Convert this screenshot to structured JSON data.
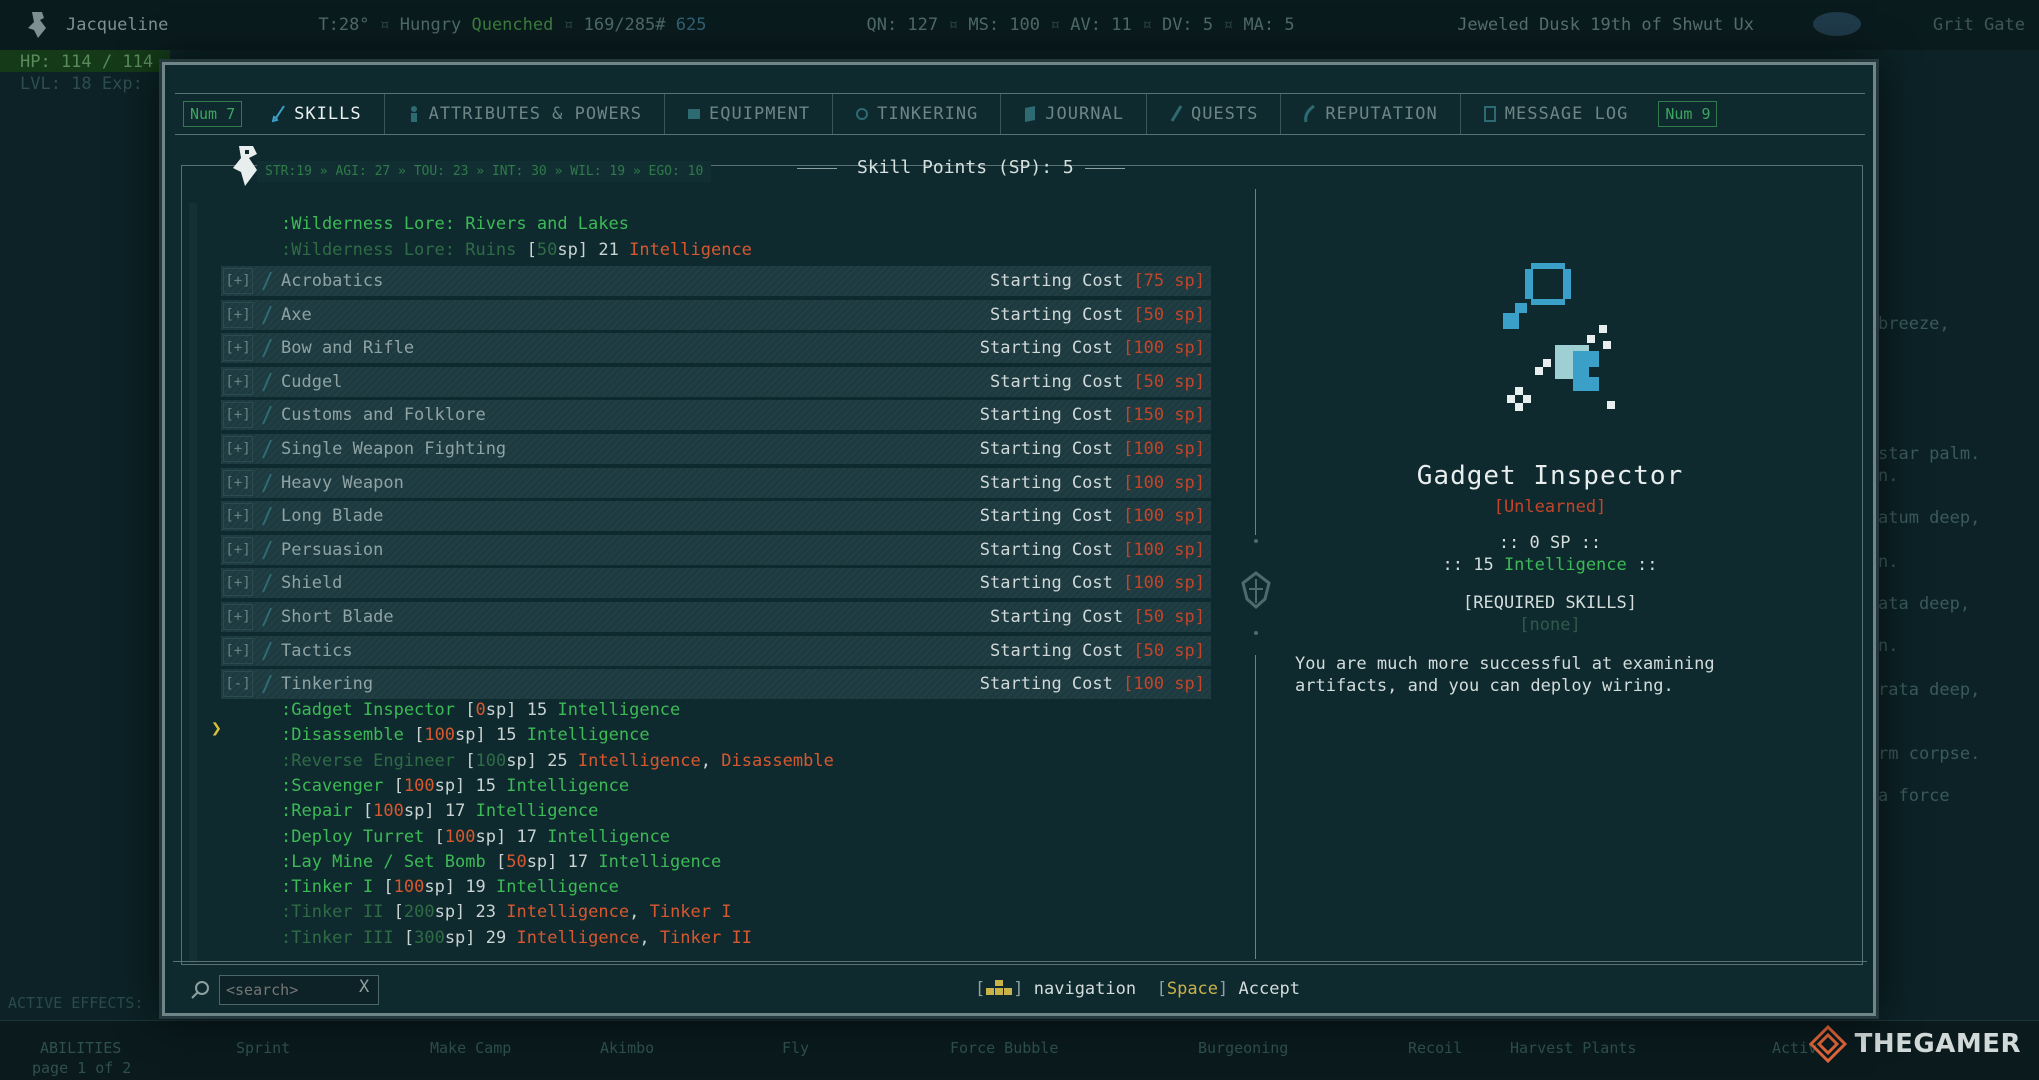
{
  "hud": {
    "player_name": "Jacqueline",
    "temperature": "T:28°",
    "hunger": "Hungry",
    "thirst": "Quenched",
    "weight": "169/285#",
    "drams": "625",
    "qn": "QN: 127",
    "ms": "MS: 100",
    "av": "AV: 11",
    "dv": "DV: 5",
    "ma": "MA: 5",
    "date": "Jeweled Dusk 19th of Shwut Ux",
    "zone": "Grit Gate",
    "hp": "HP: 114 / 114",
    "lvl": "LVL: 18 Exp:",
    "bg_lines": [
      "breeze,",
      "star palm.",
      "n.",
      "atum deep,",
      "n.",
      "ata deep,",
      "n.",
      "rata deep,",
      "rm corpse.",
      "a force"
    ],
    "active_effects": "ACTIVE EFFECTS:",
    "abilities_label": "ABILITIES",
    "abilities_page": "page 1 of 2",
    "abilities": [
      "Sprint",
      "Make Camp",
      "Akimbo",
      "Fly",
      "Force Bubble",
      "Burgeoning",
      "Recoil",
      "Harvest Plants",
      "Activ"
    ],
    "watermark": "THEGAMER"
  },
  "tabs": {
    "left_hotkey": "Num 7",
    "right_hotkey": "Num 9",
    "items": [
      {
        "label": "SKILLS",
        "icon": "sword-icon"
      },
      {
        "label": "ATTRIBUTES & POWERS",
        "icon": "figure-icon"
      },
      {
        "label": "EQUIPMENT",
        "icon": "armor-icon"
      },
      {
        "label": "TINKERING",
        "icon": "gear-icon"
      },
      {
        "label": "JOURNAL",
        "icon": "book-icon"
      },
      {
        "label": "QUESTS",
        "icon": "quill-icon"
      },
      {
        "label": "REPUTATION",
        "icon": "feather-icon"
      },
      {
        "label": "MESSAGE LOG",
        "icon": "scroll-icon"
      }
    ]
  },
  "stats_line": "STR:19 » AGI: 27 » TOU: 23 » INT: 30 » WIL: 19 » EGO: 10",
  "skill_points": "Skill Points (SP): 5",
  "subskills_top": {
    "rivers": ":Wilderness Lore: Rivers and Lakes",
    "ruins_name": ":Wilderness Lore: Ruins",
    "ruins_cost_num": "50",
    "ruins_req_num": "21",
    "ruins_req_attr": "Intelligence"
  },
  "skills": [
    {
      "name": "Acrobatics",
      "toggle": "[+]",
      "cost": "[75 sp]"
    },
    {
      "name": "Axe",
      "toggle": "[+]",
      "cost": "[50 sp]"
    },
    {
      "name": "Bow and Rifle",
      "toggle": "[+]",
      "cost": "[100 sp]"
    },
    {
      "name": "Cudgel",
      "toggle": "[+]",
      "cost": "[50 sp]"
    },
    {
      "name": "Customs and Folklore",
      "toggle": "[+]",
      "cost": "[150 sp]"
    },
    {
      "name": "Single Weapon Fighting",
      "toggle": "[+]",
      "cost": "[100 sp]"
    },
    {
      "name": "Heavy Weapon",
      "toggle": "[+]",
      "cost": "[100 sp]"
    },
    {
      "name": "Long Blade",
      "toggle": "[+]",
      "cost": "[100 sp]"
    },
    {
      "name": "Persuasion",
      "toggle": "[+]",
      "cost": "[100 sp]"
    },
    {
      "name": "Shield",
      "toggle": "[+]",
      "cost": "[100 sp]"
    },
    {
      "name": "Short Blade",
      "toggle": "[+]",
      "cost": "[50 sp]"
    },
    {
      "name": "Tactics",
      "toggle": "[+]",
      "cost": "[50 sp]"
    },
    {
      "name": "Tinkering",
      "toggle": "[-]",
      "cost": "[100 sp]"
    }
  ],
  "cost_label": "Starting Cost",
  "tinkering_subskills": [
    {
      "name": ":Gadget Inspector",
      "cost": "0",
      "level": "15",
      "reqs": [
        {
          "t": "Intelligence",
          "ok": true
        }
      ],
      "avail": true
    },
    {
      "name": ":Disassemble",
      "cost": "100",
      "level": "15",
      "reqs": [
        {
          "t": "Intelligence",
          "ok": true
        }
      ],
      "avail": true
    },
    {
      "name": ":Reverse Engineer",
      "cost": "100",
      "level": "25",
      "reqs": [
        {
          "t": "Intelligence",
          "ok": false
        },
        {
          "t": "Disassemble",
          "ok": false
        }
      ],
      "avail": false
    },
    {
      "name": ":Scavenger",
      "cost": "100",
      "level": "15",
      "reqs": [
        {
          "t": "Intelligence",
          "ok": true
        }
      ],
      "avail": true
    },
    {
      "name": ":Repair",
      "cost": "100",
      "level": "17",
      "reqs": [
        {
          "t": "Intelligence",
          "ok": true
        }
      ],
      "avail": true
    },
    {
      "name": ":Deploy Turret",
      "cost": "100",
      "level": "17",
      "reqs": [
        {
          "t": "Intelligence",
          "ok": true
        }
      ],
      "avail": true
    },
    {
      "name": ":Lay Mine / Set Bomb",
      "cost": "50",
      "level": "17",
      "reqs": [
        {
          "t": "Intelligence",
          "ok": true
        }
      ],
      "avail": true
    },
    {
      "name": ":Tinker I",
      "cost": "100",
      "level": "19",
      "reqs": [
        {
          "t": "Intelligence",
          "ok": true
        }
      ],
      "avail": true
    },
    {
      "name": ":Tinker II",
      "cost": "200",
      "level": "23",
      "reqs": [
        {
          "t": "Intelligence",
          "ok": false
        },
        {
          "t": "Tinker I",
          "ok": false
        }
      ],
      "avail": false
    },
    {
      "name": ":Tinker III",
      "cost": "300",
      "level": "29",
      "reqs": [
        {
          "t": "Intelligence",
          "ok": false
        },
        {
          "t": "Tinker II",
          "ok": false
        }
      ],
      "avail": false
    }
  ],
  "detail": {
    "title": "Gadget Inspector",
    "status": "[Unlearned]",
    "sp_line": ":: 0 SP ::",
    "req_prefix": ":: 15 ",
    "req_attr": "Intelligence",
    "req_suffix": " ::",
    "required_skills_label": "[REQUIRED SKILLS]",
    "required_skills_value": "[none]",
    "description": "You are much more successful at examining artifacts, and you can deploy wiring."
  },
  "footer": {
    "search_placeholder": "<search>",
    "search_clear": "X",
    "navigation_label": "navigation",
    "accept_key": "Space",
    "accept_label": "Accept"
  },
  "colors": {
    "available_green": "#3cba55",
    "unavailable_red": "#d7582f",
    "cost_red": "#c2452a",
    "cursor_yellow": "#d8c23a"
  }
}
